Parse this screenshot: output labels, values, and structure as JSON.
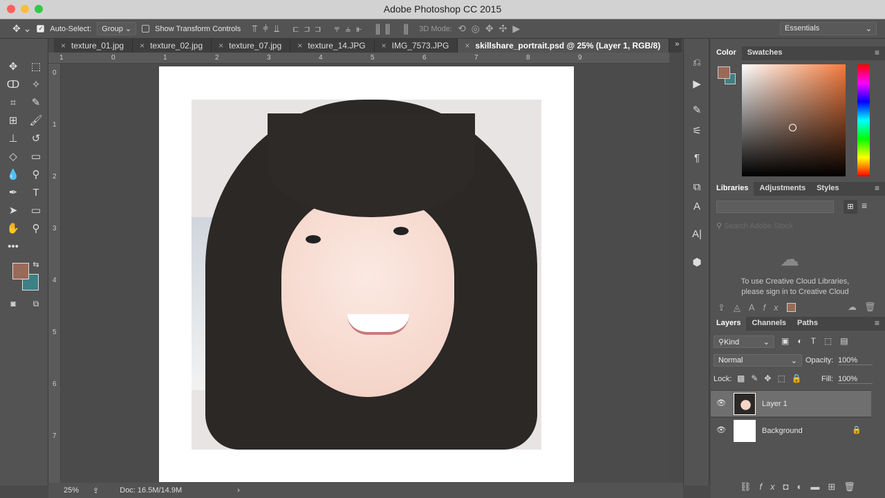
{
  "app": {
    "title": "Adobe Photoshop CC 2015"
  },
  "options": {
    "auto_select_label": "Auto-Select:",
    "auto_select_checked": true,
    "auto_select_value": "Group",
    "show_transform_label": "Show Transform Controls",
    "show_transform_checked": false,
    "mode_3d_label": "3D Mode:",
    "workspace": "Essentials"
  },
  "tabs": [
    {
      "label": "texture_01.jpg"
    },
    {
      "label": "texture_02.jpg"
    },
    {
      "label": "texture_07.jpg"
    },
    {
      "label": "texture_14.JPG"
    },
    {
      "label": "IMG_7573.JPG"
    },
    {
      "label": "skillshare_portrait.psd @ 25% (Layer 1, RGB/8)",
      "active": true
    }
  ],
  "ruler": {
    "top": [
      "1",
      "0",
      "1",
      "2",
      "3",
      "4",
      "5",
      "6",
      "7",
      "8",
      "9"
    ],
    "left": [
      "0",
      "1",
      "2",
      "3",
      "4",
      "5",
      "6",
      "7"
    ]
  },
  "status": {
    "zoom": "25%",
    "doc": "Doc: 16.5M/14.9M"
  },
  "colors": {
    "foreground": "#9a6a58",
    "background": "#3f7f86"
  },
  "color_panel": {
    "tabs": [
      "Color",
      "Swatches"
    ]
  },
  "libraries_panel": {
    "tabs": [
      "Libraries",
      "Adjustments",
      "Styles"
    ],
    "search_placeholder": "Search Adobe Stock",
    "message_line1": "To use Creative Cloud Libraries,",
    "message_line2": "please sign in to Creative Cloud"
  },
  "layers_panel": {
    "tabs": [
      "Layers",
      "Channels",
      "Paths"
    ],
    "filter": "Kind",
    "blend_mode": "Normal",
    "opacity_label": "Opacity:",
    "opacity": "100%",
    "lock_label": "Lock:",
    "fill_label": "Fill:",
    "fill": "100%",
    "layers": [
      {
        "name": "Layer 1",
        "visible": true,
        "selected": true
      },
      {
        "name": "Background",
        "visible": true,
        "locked": true
      }
    ]
  }
}
